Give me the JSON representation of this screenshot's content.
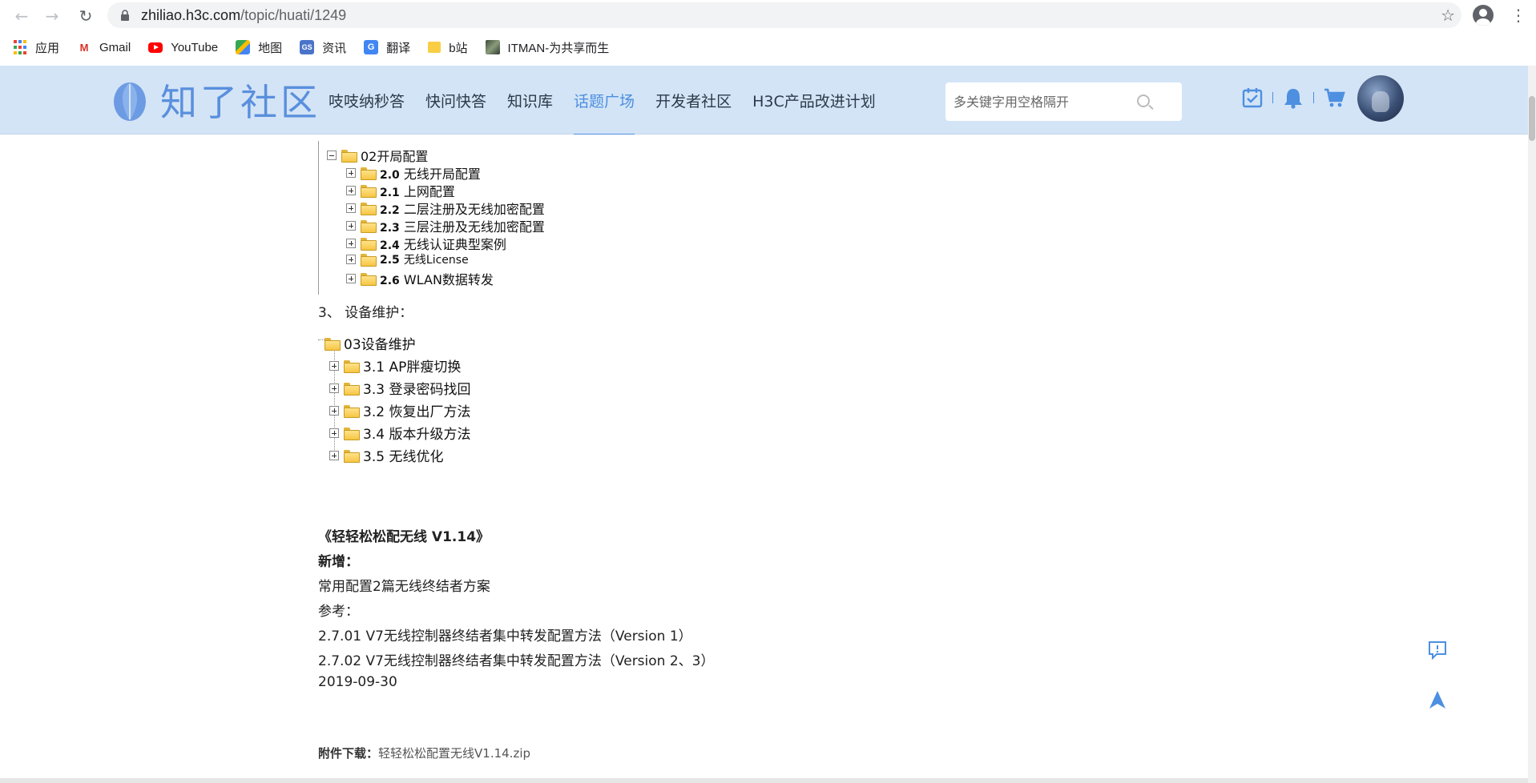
{
  "browser": {
    "url_host": "zhiliao.h3c.com",
    "url_path": "/topic/huati/1249",
    "bookmarks": [
      {
        "label": "应用",
        "icon": "apps-grid-icon"
      },
      {
        "label": "Gmail",
        "icon": "gmail-icon"
      },
      {
        "label": "YouTube",
        "icon": "youtube-icon"
      },
      {
        "label": "地图",
        "icon": "maps-icon"
      },
      {
        "label": "资讯",
        "icon": "news-icon"
      },
      {
        "label": "翻译",
        "icon": "translate-icon"
      },
      {
        "label": "b站",
        "icon": "folder-icon"
      },
      {
        "label": "ITMAN-为共享而生",
        "icon": "itman-thumbnail-icon"
      }
    ]
  },
  "header": {
    "logo_text": "知了社区",
    "nav": [
      {
        "label": "吱吱纳秒答",
        "active": false
      },
      {
        "label": "快问快答",
        "active": false
      },
      {
        "label": "知识库",
        "active": false
      },
      {
        "label": "话题广场",
        "active": true
      },
      {
        "label": "开发者社区",
        "active": false
      },
      {
        "label": "H3C产品改进计划",
        "active": false
      }
    ],
    "search_placeholder": "多关键字用空格隔开",
    "accent_color": "#4d8fe0"
  },
  "tree1": {
    "root": "02开局配置",
    "items": [
      {
        "num": "2.0",
        "text": "无线开局配置"
      },
      {
        "num": "2.1",
        "text": "上网配置"
      },
      {
        "num": "2.2",
        "text": "二层注册及无线加密配置"
      },
      {
        "num": "2.3",
        "text": "三层注册及无线加密配置"
      },
      {
        "num": "2.4",
        "text": "无线认证典型案例"
      },
      {
        "num": "2.5",
        "text": "无线License"
      },
      {
        "num": "2.6",
        "text": "WLAN数据转发"
      }
    ]
  },
  "section3": {
    "title": "3、  设备维护："
  },
  "tree2": {
    "root": "03设备维护",
    "items": [
      {
        "text": "3.1 AP胖瘦切换"
      },
      {
        "text": "3.3 登录密码找回"
      },
      {
        "text": "3.2 恢复出厂方法"
      },
      {
        "text": "3.4 版本升级方法"
      },
      {
        "text": "3.5 无线优化"
      }
    ]
  },
  "article": {
    "book_title": "《轻轻松松配无线 V1.14》",
    "new_label": "新增：",
    "new_text": "常用配置2篇无线终结者方案",
    "ref_label": "参考：",
    "ref1": "2.7.01  V7无线控制器终结者集中转发配置方法（Version 1）",
    "ref2": "2.7.02  V7无线控制器终结者集中转发配置方法（Version 2、3）",
    "date": "2019-09-30"
  },
  "attachment": {
    "label": "附件下载：",
    "file": "轻轻松松配置无线V1.14.zip"
  }
}
